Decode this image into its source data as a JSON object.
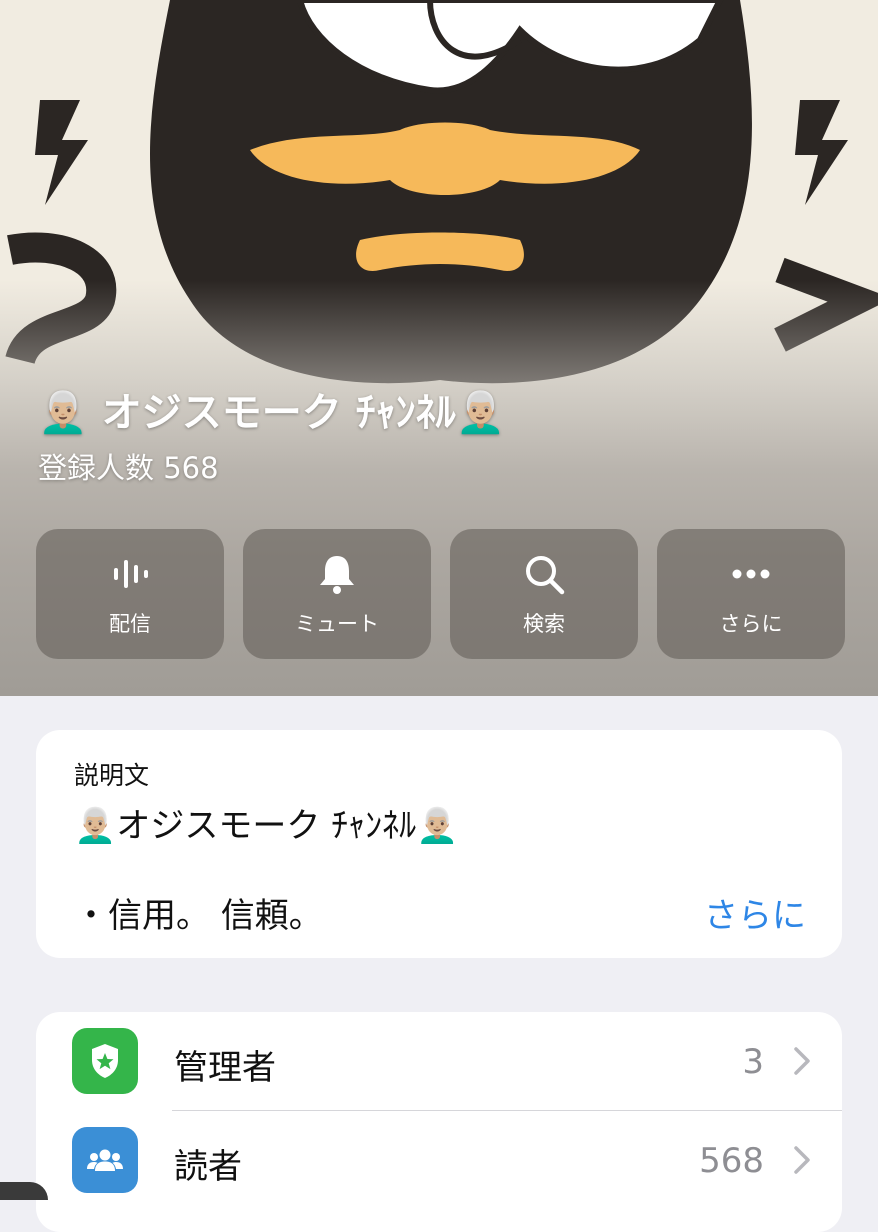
{
  "channel": {
    "title": "👨🏼‍🦳 オジスモーク ﾁｬﾝﾈﾙ👨🏼‍🦳",
    "subscribers": "登録人数 568"
  },
  "actions": [
    {
      "label": "配信",
      "icon": "broadcast-waveform-icon"
    },
    {
      "label": "ミュート",
      "icon": "bell-icon"
    },
    {
      "label": "検索",
      "icon": "search-icon"
    },
    {
      "label": "さらに",
      "icon": "more-dots-icon"
    }
  ],
  "description": {
    "heading": "説明文",
    "title": "👨🏼‍🦳オジスモーク ﾁｬﾝﾈﾙ👨🏼‍🦳",
    "line": "・信用。 信頼。",
    "more": "さらに"
  },
  "list": [
    {
      "label": "管理者",
      "count": "3",
      "icon": "shield-star-icon",
      "icon_color": "#34b54a"
    },
    {
      "label": "読者",
      "count": "568",
      "icon": "people-group-icon",
      "icon_color": "#3b8fd6"
    }
  ],
  "colors": {
    "accent_link": "#2e86e6",
    "background": "#efeff4"
  }
}
